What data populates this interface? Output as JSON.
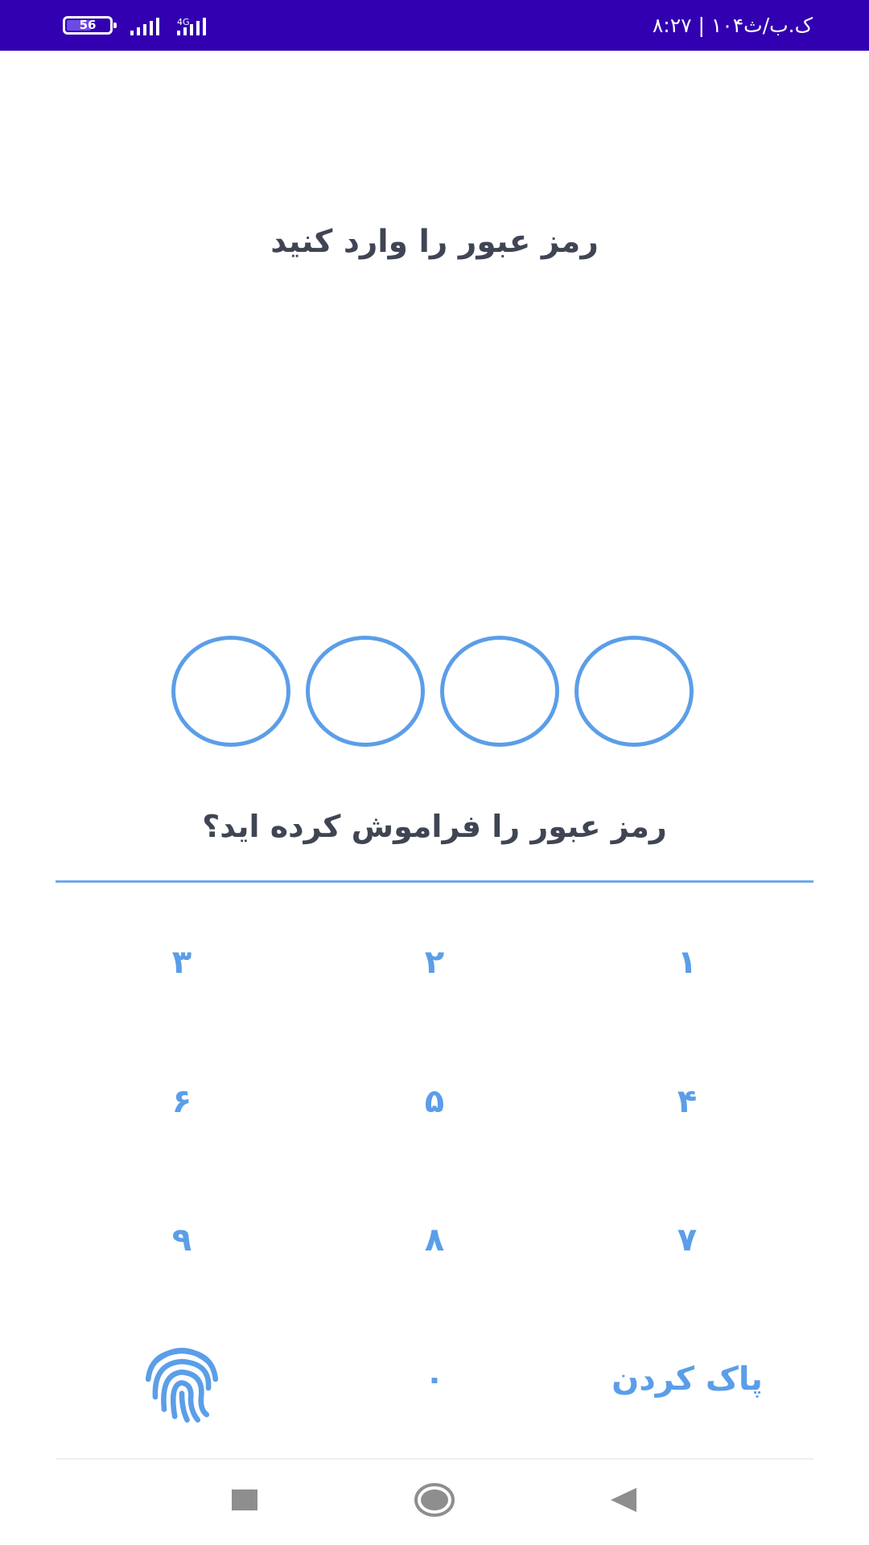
{
  "status_bar": {
    "time": "۸:۲۷ | ۱۰۴ک.ب/ث",
    "battery_level": "56",
    "battery_fraction": 0.56,
    "network_type": "4G",
    "background_color": "#3200b0"
  },
  "lock_screen": {
    "title": "رمز عبور را وارد کنید",
    "pin_length": 4,
    "pin_filled": 0,
    "forgot_password": "رمز عبور را فراموش کرده اید؟",
    "accent_color": "#5b9ee8"
  },
  "keypad": {
    "keys": [
      "۱",
      "۲",
      "۳",
      "۴",
      "۵",
      "۶",
      "۷",
      "۸",
      "۹"
    ],
    "clear_label": "پاک کردن",
    "zero": "۰",
    "fingerprint_icon": "fingerprint-icon"
  },
  "nav_bar": {
    "recents_icon": "square-icon",
    "home_icon": "circle-icon",
    "back_icon": "triangle-back-icon"
  }
}
